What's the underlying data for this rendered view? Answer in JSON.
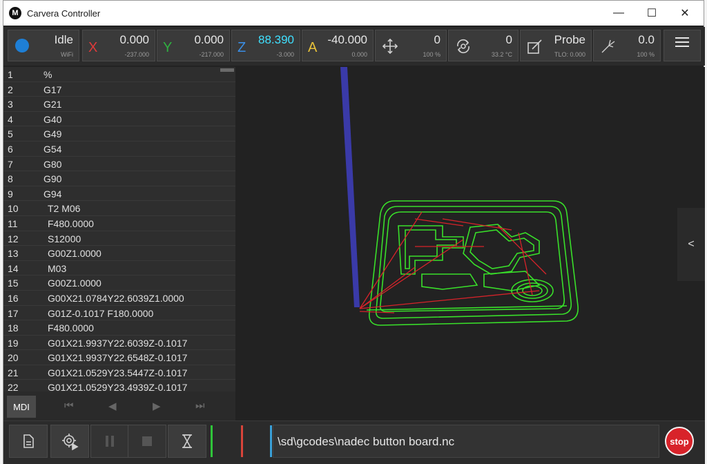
{
  "window": {
    "title": "Carvera Controller",
    "logo": "M"
  },
  "window_controls": {
    "minimize": "—",
    "maximize": "☐",
    "close": "✕"
  },
  "status": {
    "state": "Idle",
    "connection": "WiFi",
    "x": {
      "axis": "X",
      "value": "0.000",
      "work": "-237.000",
      "color": "#e03a3a"
    },
    "y": {
      "axis": "Y",
      "value": "0.000",
      "work": "-217.000",
      "color": "#2fb040"
    },
    "z": {
      "axis": "Z",
      "value": "88.390",
      "work": "-3.000",
      "color": "#3a8ee6",
      "value_color": "#3fe0ff"
    },
    "a": {
      "axis": "A",
      "value": "-40.000",
      "work": "0.000",
      "color": "#e8c23a"
    },
    "feed": {
      "value": "0",
      "sub": "100 %"
    },
    "spindle": {
      "value": "0",
      "sub": "33.2 °C"
    },
    "probe": {
      "label": "Probe",
      "sub": "TLO: 0.000"
    },
    "laser": {
      "value": "0.0",
      "sub": "100 %"
    }
  },
  "gcode_lines": [
    {
      "n": "1",
      "code": "%"
    },
    {
      "n": "2",
      "code": "G17"
    },
    {
      "n": "3",
      "code": "G21"
    },
    {
      "n": "4",
      "code": "G40"
    },
    {
      "n": "5",
      "code": "G49"
    },
    {
      "n": "6",
      "code": "G54"
    },
    {
      "n": "7",
      "code": "G80"
    },
    {
      "n": "8",
      "code": "G90"
    },
    {
      "n": "9",
      "code": "G94"
    },
    {
      "n": "10",
      "code": "T2 M06"
    },
    {
      "n": "11",
      "code": "F480.0000"
    },
    {
      "n": "12",
      "code": "S12000"
    },
    {
      "n": "13",
      "code": "G00Z1.0000"
    },
    {
      "n": "14",
      "code": "M03"
    },
    {
      "n": "15",
      "code": "G00Z1.0000"
    },
    {
      "n": "16",
      "code": "G00X21.0784Y22.6039Z1.0000"
    },
    {
      "n": "17",
      "code": "G01Z-0.1017 F180.0000"
    },
    {
      "n": "18",
      "code": "F480.0000"
    },
    {
      "n": "19",
      "code": "G01X21.9937Y22.6039Z-0.1017"
    },
    {
      "n": "20",
      "code": "G01X21.9937Y22.6548Z-0.1017"
    },
    {
      "n": "21",
      "code": "G01X21.0529Y23.5447Z-0.1017"
    },
    {
      "n": "22",
      "code": "G01X21.0529Y23.4939Z-0.1017"
    }
  ],
  "controls": {
    "mdi": "MDI",
    "first": "⏮",
    "prev": "◀",
    "next": "▶",
    "last": "⏭"
  },
  "view": {
    "collapse_label": "<"
  },
  "bottom": {
    "file_path": "\\sd\\gcodes\\nadec button board.nc",
    "stop_label": "stop",
    "bar_colors": [
      "#2fc43a",
      "#d8443a",
      "#3aa0d8"
    ]
  },
  "colors": {
    "path_green": "#39e02a",
    "path_red": "#d8232a",
    "tool_blue": "#3a3aa8"
  }
}
